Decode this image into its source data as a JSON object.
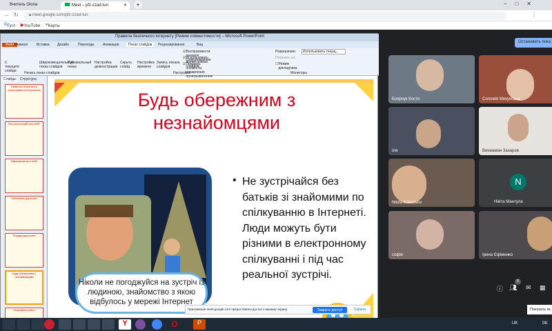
{
  "browser": {
    "tabs": [
      {
        "label": "Вчитель Gloria"
      },
      {
        "label": "Meet – pfz-zzad-tun"
      }
    ],
    "url": "meet.google.com/pfz-zzad-tun",
    "bookmarks": [
      "Гугл",
      "YouTube",
      "Карты"
    ]
  },
  "ppt": {
    "window_title": "Правила безпечного інтернету [Режим совместимости] – Microsoft PowerPoint",
    "ribbon_tabs": [
      "Главная",
      "Вставка",
      "Дизайн",
      "Переходы",
      "Анимация",
      "Показ слайдов",
      "Рецензирование",
      "Вид"
    ],
    "ribbon_buttons": [
      "С текущего слайда",
      "Широковещательный показ слайдов",
      "Произвольный показ",
      "Настройка демонстрации",
      "Скрыть слайд",
      "Настройка времени",
      "Запись показа слайдов"
    ],
    "group_labels": [
      "Начать показ слайдов",
      "Настройка",
      "Мониторы"
    ],
    "checkboxes": [
      "Воспроизвести речевое сопровождение",
      "Использовать время показа слайдов",
      "Показать элементы управления проигрывателем"
    ],
    "resolution_label": "Разрешение:",
    "resolution_value": "Использовать текущ...",
    "show_on_label": "Показать на:",
    "presenter_label": "Режим докладчика",
    "outline_tabs": [
      "Слайды",
      "Структура"
    ],
    "thumbnails": [
      "Правила безпечного користування Інтернетом",
      "Не розголошуй про себе",
      "Інформація про себе",
      "Запитуйте дорослих",
      "Поради дорослих",
      "Будь обережним з незнайомцями",
      "Незнайомі сайти"
    ]
  },
  "slide": {
    "title": "Будь обережним з незнайомцями",
    "bullet": "Не зустрічайся без батьків зі знайомими по спілкуванню в Інтернеті. Люди можуть бути різними в електронному спілкуванні і під час реальної зустрічі.",
    "caption": "Ніколи не погоджуйся на зустріч із людиною, знайомство з якою відбулось у мережі Інтернет"
  },
  "share_bar": {
    "text": "Приложение meet.google.com предоставлен доступ к вашему экрану.",
    "button": "Закрыть доступ",
    "hide": "Скрыть"
  },
  "meet": {
    "stop_button": "Остановить пока",
    "participants": [
      {
        "name": "Боярчук Костя"
      },
      {
        "name": "Соломія Мекунська"
      },
      {
        "name": "Іля"
      },
      {
        "name": "Вениамин Захаров"
      },
      {
        "name": "Nikita Kalerusov"
      },
      {
        "name": "Нікіта Мантула"
      },
      {
        "name": "софія"
      },
      {
        "name": "Ірина Єфіменко"
      }
    ],
    "avatar_letter": "N",
    "participant_count": "9",
    "show_all": "Показать вс"
  },
  "taskbar": {
    "lang": "UK",
    "time": "08:"
  },
  "colors": {
    "meet_bg": "#202124",
    "accent": "#1a73e8",
    "title_red": "#d6001c",
    "avatar_bg": "#00796b"
  }
}
